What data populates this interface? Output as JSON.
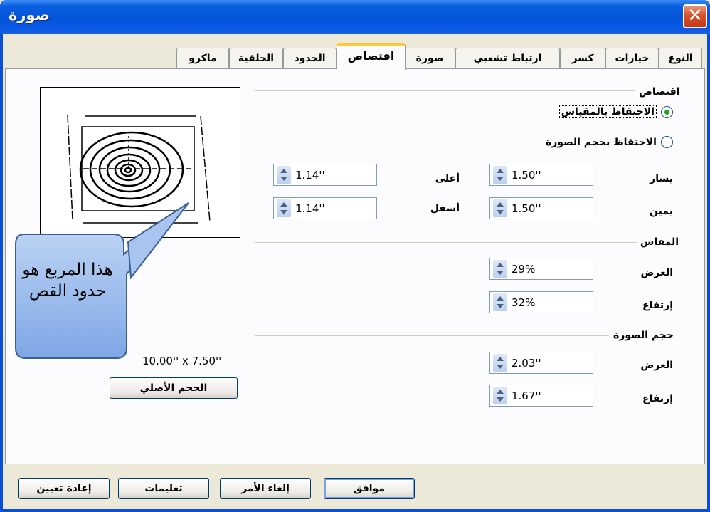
{
  "window": {
    "title": "صورة",
    "close_label": "✕"
  },
  "tabs": [
    {
      "label": "النوع",
      "active": false
    },
    {
      "label": "خيارات",
      "active": false
    },
    {
      "label": "كسر",
      "active": false
    },
    {
      "label": "ارتباط تشعبي",
      "active": false
    },
    {
      "label": "صورة",
      "active": false
    },
    {
      "label": "اقتصاص",
      "active": true
    },
    {
      "label": "الحدود",
      "active": false
    },
    {
      "label": "الخلفية",
      "active": false
    },
    {
      "label": "ماكرو",
      "active": false
    }
  ],
  "crop": {
    "group_label": "اقتصاص",
    "keep_scale_label": "الاحتفاظ بالمقياس",
    "keep_image_size_label": "الاحتفاظ بحجم الصورة",
    "keep_scale_selected": true,
    "left_label": "يسار",
    "left_value": "1.50''",
    "right_label": "يمين",
    "right_value": "1.50''",
    "top_label": "أعلى",
    "top_value": "1.14''",
    "bottom_label": "أسفل",
    "bottom_value": "1.14''"
  },
  "scale": {
    "group_label": "المقاس",
    "width_label": "العرض",
    "width_value": "29%",
    "height_label": "إرتفاع",
    "height_value": "32%"
  },
  "image_size": {
    "group_label": "حجم الصورة",
    "width_label": "العرض",
    "width_value": "2.03''",
    "height_label": "إرتفاع",
    "height_value": "1.67''"
  },
  "original": {
    "size_text": "10.00'' x 7.50''",
    "button_label": "الحجم الأصلي"
  },
  "callout": {
    "text": "هذا المربع هو حدود القص"
  },
  "buttons": {
    "ok": "موافق",
    "cancel": "إلغاء الأمر",
    "help": "تعليمات",
    "reset": "إعادة تعيين"
  }
}
